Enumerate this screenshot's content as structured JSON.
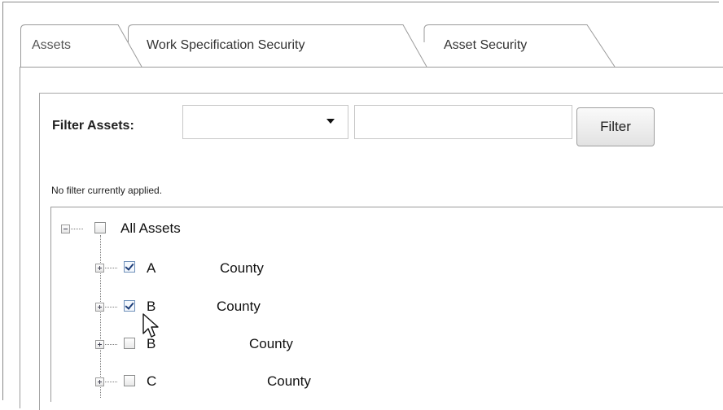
{
  "tabs": [
    {
      "label": "Assets",
      "active": true
    },
    {
      "label": "Work Specification Security",
      "active": false
    },
    {
      "label": "Asset Security",
      "active": false
    }
  ],
  "filter": {
    "label": "Filter Assets:",
    "select_value": "",
    "text_value": "",
    "button_label": "Filter"
  },
  "status_text": "No filter currently applied.",
  "tree": {
    "root": {
      "label": "All Assets",
      "checked": false,
      "expanded": true
    },
    "children": [
      {
        "code": "A",
        "name": "County",
        "checked": true
      },
      {
        "code": "B",
        "name": "County",
        "checked": true
      },
      {
        "code": "B",
        "name": "County",
        "checked": false
      },
      {
        "code": "C",
        "name": "County",
        "checked": false
      }
    ]
  },
  "colors": {
    "border": "#9a9a9a",
    "check": "#1e3e78"
  }
}
